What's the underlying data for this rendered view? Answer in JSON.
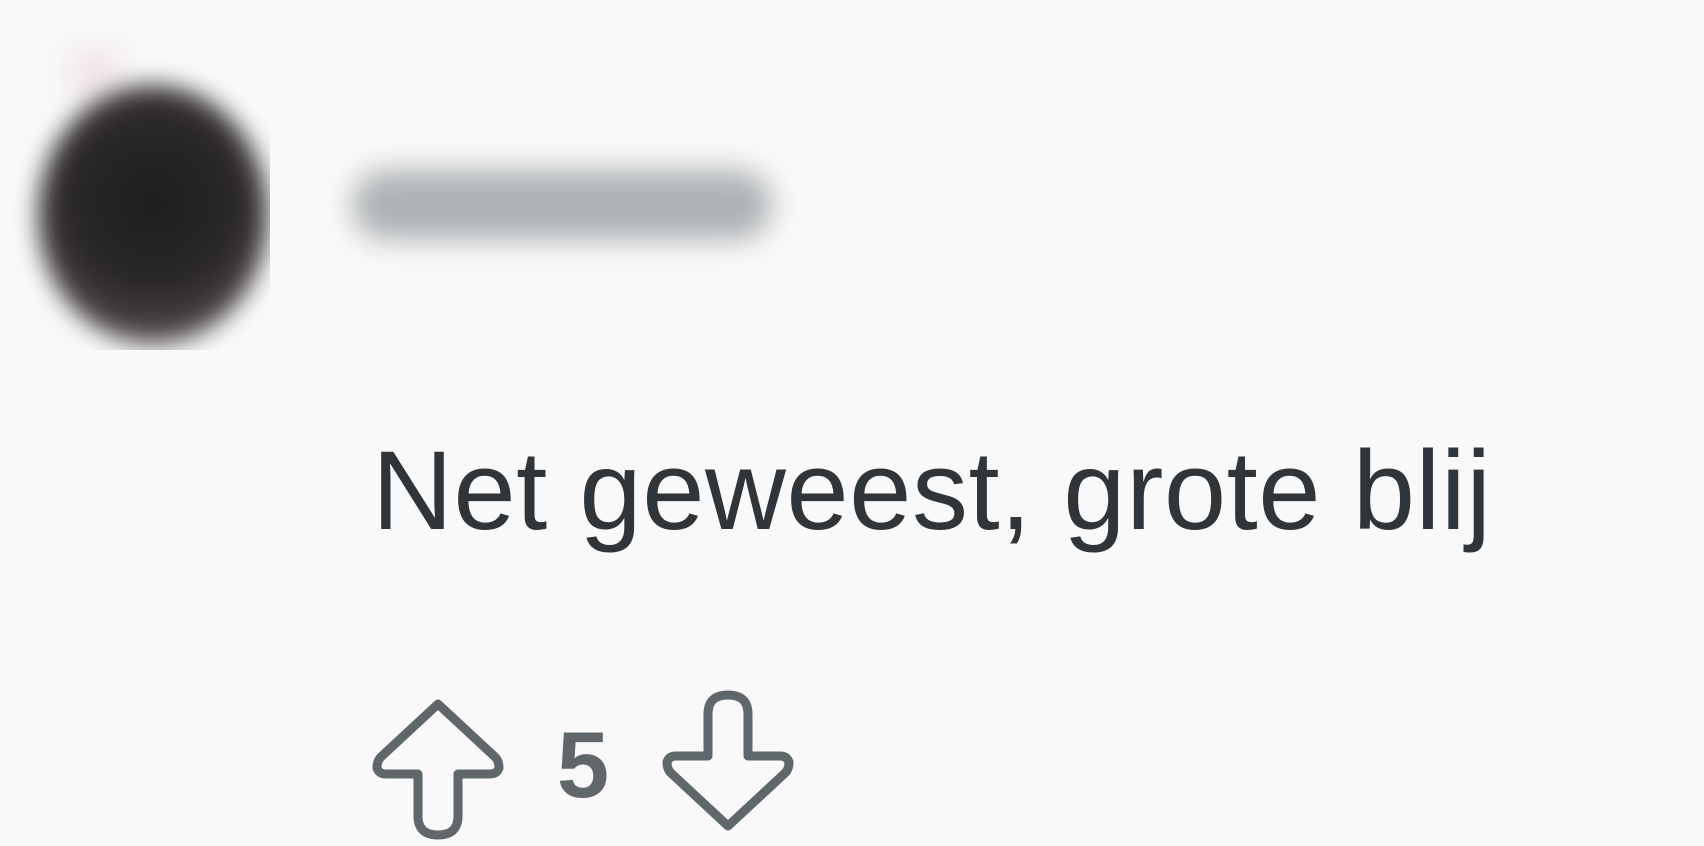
{
  "comment": {
    "author_name": "",
    "text": "Net geweest, grote blij",
    "votes": {
      "score": "5",
      "upvote_icon": "arrow-up-outline",
      "downvote_icon": "arrow-down-outline"
    }
  },
  "colors": {
    "background": "#f9f9fa",
    "text": "#2f3538",
    "icon": "#5f676b"
  }
}
